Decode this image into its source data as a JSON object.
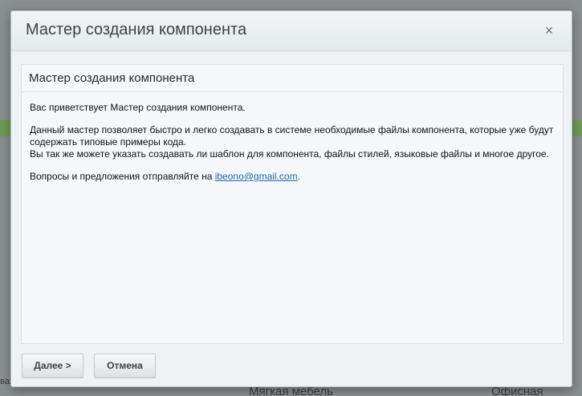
{
  "dialog": {
    "title": "Мастер создания компонента",
    "close_glyph": "×"
  },
  "panel": {
    "heading": "Мастер создания компонента",
    "greeting": "Вас приветствует Мастер создания компонента.",
    "description_line1": "Данный мастер позволяет быстро и легко создавать в системе необходимые файлы компонента, которые уже будут содержать типовые примеры кода.",
    "description_line2": "Вы так же можете указать создавать ли шаблон для компонента, файлы стилей, языковые файлы и многое другое.",
    "contact_prefix": "Вопросы и предложения отправляйте на ",
    "contact_email": "ibeono@gmail.com",
    "contact_suffix": "."
  },
  "footer": {
    "next_label": "Далее >",
    "cancel_label": "Отмена"
  },
  "background": {
    "text_center": "Мягкая мебель",
    "text_right": "Офисная мебель",
    "text_left": "важнейшее"
  }
}
